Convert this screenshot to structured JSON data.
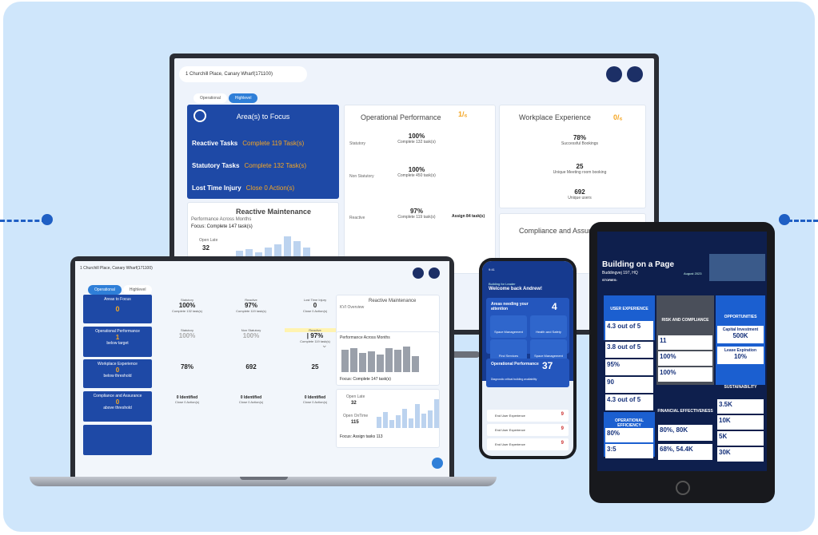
{
  "monitor": {
    "location": "1 Churchill Place, Canary Wharf(171100)",
    "tabs": [
      "Operational",
      "Highlevel"
    ],
    "focus_title": "Area(s) to Focus",
    "focus_rows": [
      {
        "label": "Reactive Tasks",
        "value": "Complete 119 Task(s)"
      },
      {
        "label": "Statutory Tasks",
        "value": "Complete 132 Task(s)"
      },
      {
        "label": "Lost Time Injury",
        "value": "Close 0 Action(s)"
      }
    ],
    "rm_title": "Reactive Maintenance",
    "rm_subtitle": "Performance Across Months",
    "rm_focus": "Focus: Complete 147 task(s)",
    "rm_open_label": "Open Late",
    "rm_open_value": "32",
    "op_title": "Operational Performance",
    "op_score": "1/₆",
    "op_rows": [
      {
        "label": "Statutory",
        "value": "100%",
        "sub": "Complete 132 task(s)"
      },
      {
        "label": "Non Statutory",
        "value": "100%",
        "sub": "Complete 450 task(s)"
      },
      {
        "label": "Reactive",
        "value": "97%",
        "sub": "Complete 119 task(s)"
      }
    ],
    "op_assign": "Assign 84 task(s)",
    "we_title": "Workplace Experience",
    "we_score": "0/₆",
    "we_rows": [
      {
        "value": "78%",
        "sub": "Successful Bookings"
      },
      {
        "value": "25",
        "sub": "Unique Meeting room booking"
      },
      {
        "value": "692",
        "sub": "Unique users"
      }
    ],
    "comp_title": "Compliance and Assurance"
  },
  "laptop": {
    "location": "1 Churchill Place, Canary Wharf(171100)",
    "tabs": [
      "Operational",
      "Highlevel"
    ],
    "left": [
      {
        "title": "Areas to Focus",
        "value": "0"
      },
      {
        "title": "Operational Performance",
        "value": "1",
        "sub": "below target"
      },
      {
        "title": "Workplace Experience",
        "value": "0",
        "sub": "below threshold"
      },
      {
        "title": "Compliance and Assurance",
        "value": "0",
        "sub": "above threshold"
      }
    ],
    "r1": [
      {
        "h": "Statutory",
        "v": "100%",
        "s": "Complete 132 task(s)"
      },
      {
        "h": "Reactive",
        "v": "97%",
        "s": "Complete 119 task(s)"
      },
      {
        "h": "Lost Time Injury",
        "v": "0",
        "s": "Close 0 Action(s)"
      }
    ],
    "r2": [
      {
        "h": "Statutory",
        "v": "100%"
      },
      {
        "h": "Non Statutory",
        "v": "100%"
      },
      {
        "h": "Reactive",
        "v": "| 97%",
        "s": "Complete 119 task(s)"
      }
    ],
    "r3": [
      {
        "v": "78%"
      },
      {
        "v": "692"
      },
      {
        "v": "25"
      }
    ],
    "r4": [
      {
        "v": "0 Identified",
        "s": "Close 0 Action(s)"
      },
      {
        "v": "0 Identified",
        "s": "Close 0 Action(s)"
      },
      {
        "v": "0 Identified",
        "s": "Close 0 Action(s)"
      }
    ],
    "rm_title": "Reactive Maintenance",
    "rm_kpi": "KVI Overview",
    "pm_title": "Performance Across Months",
    "pm_focus": "Focus: Complete 147 task(s)",
    "ol_label": "Open Late",
    "ol_value": "32",
    "od_label": "Open OnTime",
    "od_value": "115",
    "ol_focus": "Focus: Assign tasks 113"
  },
  "phone": {
    "time": "9:41",
    "subtitle": "Building for Leader",
    "welcome": "Welcome back Andrew!",
    "attention": "Areas needing your attention",
    "attention_count": "4",
    "buttons": [
      "Space Management",
      "Health and Safety",
      "Find Services",
      "Space Management"
    ],
    "op_label": "Operational Performance",
    "op_value": "37",
    "op_sub": "Diagnostic critical building availability",
    "rows": [
      {
        "label": "End User Experience",
        "value": "9"
      },
      {
        "label": "End User Experience",
        "value": "9"
      },
      {
        "label": "End User Experience",
        "value": "9"
      }
    ]
  },
  "tablet": {
    "title": "Building on a Page",
    "subtitle": "Buddingvej 197, HQ",
    "date": "August 2023",
    "stories": "STORIES:",
    "panels": [
      "USER EXPERIENCE",
      "RISK AND COMPLIANCE",
      "OPPORTUNITIES",
      "SUSTAINABILITY",
      "OPERATIONAL EFFICIENCY",
      "FINANCIAL EFFECTIVENESS"
    ],
    "ux": [
      "4.3 out of 5",
      "3.8 out of 5",
      "95%",
      "90",
      "4.3 out of 5"
    ],
    "risk": [
      "11",
      "100%",
      "100%"
    ],
    "opp": [
      {
        "l": "Capital Investment",
        "v": "500K"
      },
      {
        "l": "Lease Expiration",
        "v": "10%"
      }
    ],
    "sus": [
      "3.5K",
      "10K",
      "5K",
      "30K"
    ],
    "oe": [
      "80%",
      "3:5"
    ],
    "fin": [
      "80%, 80K",
      "68%, 54.4K"
    ]
  }
}
